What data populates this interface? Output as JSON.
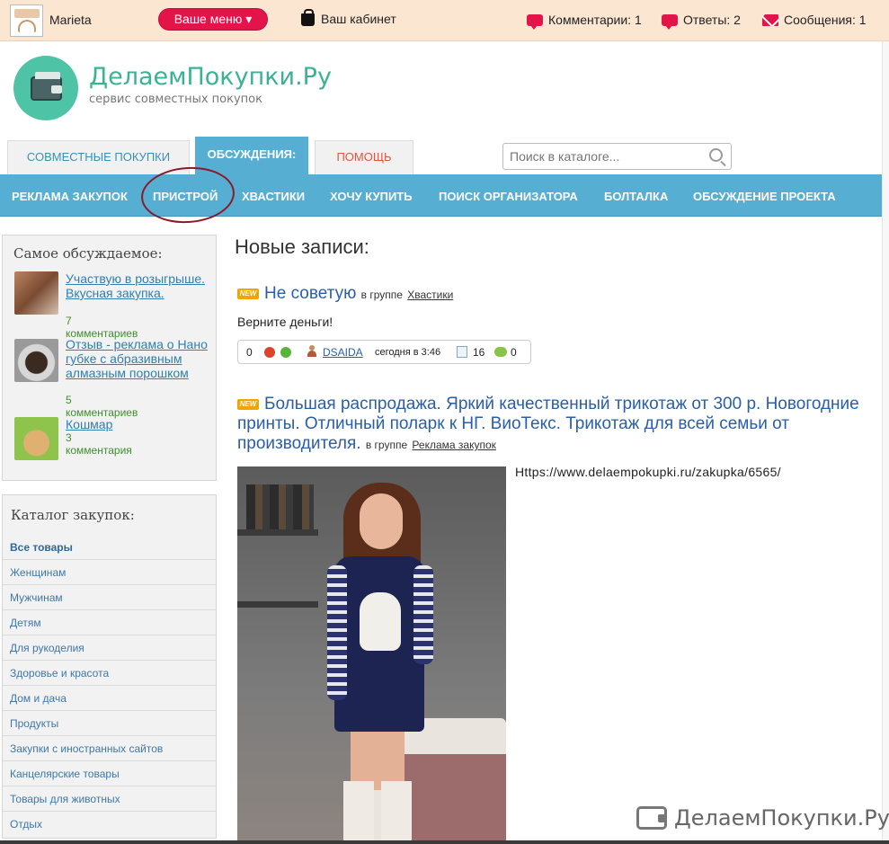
{
  "topbar": {
    "username": "Marieta",
    "menu_label": "Ваше меню ▾",
    "cabinet_label": "Ваш кабинет",
    "comments_label": "Комментарии: 1",
    "answers_label": "Ответы: 2",
    "messages_label": "Сообщения: 1"
  },
  "logo": {
    "title": "ДелаемПокупки.Ру",
    "subtitle": "сервис совместных покупок"
  },
  "tabs": [
    {
      "label": "Совместные покупки"
    },
    {
      "label": "Обсуждения:"
    },
    {
      "label": "Помощь"
    }
  ],
  "search": {
    "placeholder": "Поиск в каталоге..."
  },
  "subnav": [
    {
      "label": "Реклама закупок"
    },
    {
      "label": "Пристрой"
    },
    {
      "label": "Хвастики"
    },
    {
      "label": "Хочу купить"
    },
    {
      "label": "Поиск организатора"
    },
    {
      "label": "Болталка"
    },
    {
      "label": "Обсуждение проекта"
    }
  ],
  "sidebar": {
    "popular_title": "Самое обсуждаемое:",
    "popular": [
      {
        "title": "Участвую в розыгрыше. Вкусная закупка.",
        "count": "7 комментариев"
      },
      {
        "title": "Отзыв - реклама о Нано губке с абразивным алмазным порошком",
        "count": "5 комментариев"
      },
      {
        "title": "Кошмар",
        "count": "3 комментария"
      }
    ],
    "catalog_title": "Каталог закупок:",
    "catalog": [
      "Все товары",
      "Женщинам",
      "Мужчинам",
      "Детям",
      "Для рукоделия",
      "Здоровье и красота",
      "Дом и дача",
      "Продукты",
      "Закупки с иностранных сайтов",
      "Канцелярские товары",
      "Товары для животных",
      "Отдых"
    ]
  },
  "main": {
    "title": "Новые записи:",
    "new_badge": "NEW",
    "group_prefix": "в группе",
    "posts": [
      {
        "title": "Не советую",
        "group": "Хвастики",
        "body": "Верните деньги!",
        "rating": "0",
        "author": "DSAIDA",
        "time": "сегодня в 3:46",
        "views": "16",
        "comments": "0"
      },
      {
        "title": "Большая распродажа. Яркий качественный трикотаж от 300 р. Новогодние принты. Отличный поларк к НГ. ВиоТекс. Трикотаж для всей семьи от производителя.",
        "group": "Реклама закупок",
        "url": "Https://www.delaempokupki.ru/zakupka/6565/"
      }
    ]
  },
  "watermark": {
    "text": "ДелаемПокупки.Ру"
  },
  "colors": {
    "accent_blue": "#56aed3",
    "brand_green": "#3ab394",
    "menu_red": "#e2144a",
    "topbar_bg": "#fbe6d2"
  }
}
